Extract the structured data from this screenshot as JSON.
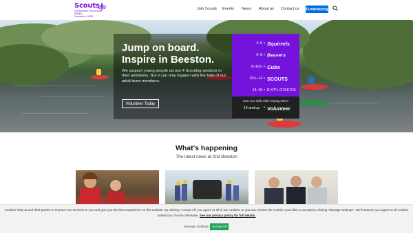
{
  "brand": {
    "name": "Scouts",
    "group_line1": "2nd Beeston Sea Scouts",
    "group_line2": "(RN40)",
    "group_line3": "Founded in 1928",
    "color": "#7413dc"
  },
  "nav": {
    "items": [
      "Join Scouts",
      "Events",
      "News",
      "About us",
      "Contact us"
    ],
    "cta_label": "Fundraising",
    "cta_color": "#006ddf",
    "search_icon": "search-icon"
  },
  "hero": {
    "title_line1": "Jump on board.",
    "title_line2": "Inspire in Beeston.",
    "body": "We support young people across 4 Scouting sections in their ambitions. But it can only happen with the help of our adult team members.",
    "button_label": "Volunteer Today"
  },
  "sections_panel": {
    "rows": [
      {
        "age": "4–6",
        "name": "Squirrels",
        "color": "#ffffff"
      },
      {
        "age": "6–8",
        "name": "Beavers",
        "color": "#ffffff"
      },
      {
        "age": "8–10½",
        "name": "Cubs",
        "color": "#ffffff"
      },
      {
        "age": "10½–14",
        "name": "SCOUTS",
        "color": "#ffffff"
      },
      {
        "age": "14–18",
        "name": "EXPLORERS",
        "color": "#ffffff"
      }
    ],
    "footer_note": "Gain new skills while helping others",
    "footer_age": "14 and up",
    "footer_name": "Volunteer"
  },
  "news": {
    "title": "What's happening",
    "subtitle": "The latest news at 2nd Beeston"
  },
  "cookie": {
    "text": "Cookies help us and third parties to improve our services to you and give you the best experience on this website. By clicking \"Accept All\" you agree to all of our cookies, or you can choose the cookies you'd like to accept by clicking \"Manage Settings\". We'll assume you agree to all cookies unless you choose otherwise.",
    "link_text": "See our privacy policy for full details.",
    "manage_label": "Manage Settings",
    "accept_label": "Accept All",
    "accept_color": "#23a455"
  }
}
